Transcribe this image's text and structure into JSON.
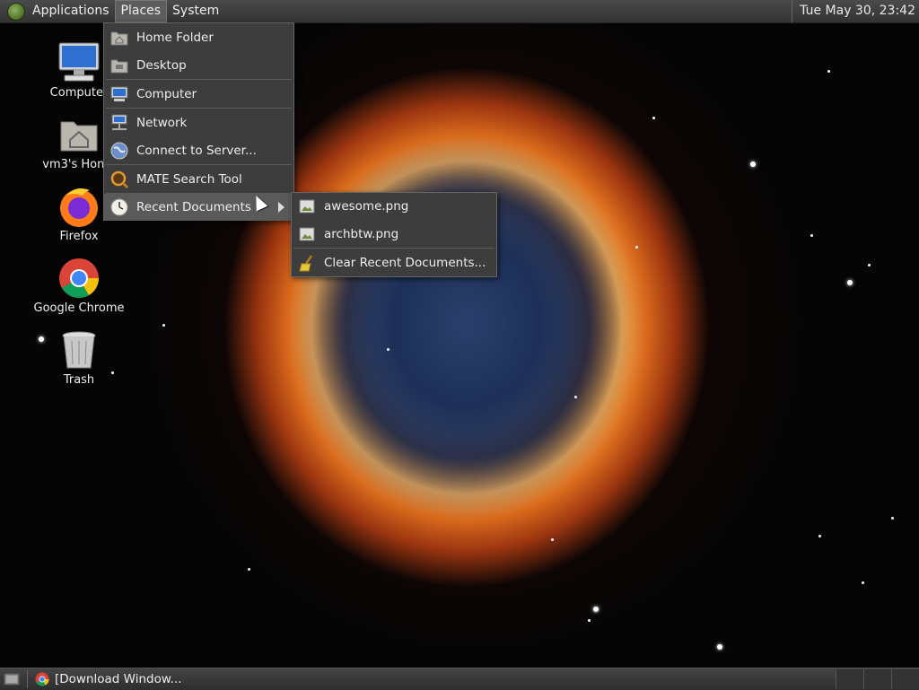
{
  "top_panel": {
    "menus": [
      "Applications",
      "Places",
      "System"
    ],
    "clock": "Tue May 30, 23:42"
  },
  "desktop_icons": [
    {
      "label": "Computer",
      "icon": "computer-icon"
    },
    {
      "label": "vm3's Home",
      "icon": "home-folder-icon"
    },
    {
      "label": "Firefox",
      "icon": "firefox-icon"
    },
    {
      "label": "Google Chrome",
      "icon": "chrome-icon"
    },
    {
      "label": "Trash",
      "icon": "trash-icon"
    }
  ],
  "places_menu": {
    "items": [
      {
        "label": "Home Folder",
        "icon": "home-folder-icon"
      },
      {
        "label": "Desktop",
        "icon": "desktop-folder-icon"
      },
      {
        "label": "Computer",
        "icon": "computer-icon"
      },
      {
        "label": "Network",
        "icon": "network-icon"
      },
      {
        "label": "Connect to Server...",
        "icon": "globe-icon"
      },
      {
        "label": "MATE Search Tool",
        "icon": "search-icon"
      },
      {
        "label": "Recent Documents",
        "icon": "clock-icon"
      }
    ]
  },
  "recent_menu": {
    "items": [
      {
        "label": "awesome.png",
        "icon": "image-file-icon"
      },
      {
        "label": "archbtw.png",
        "icon": "image-file-icon"
      },
      {
        "label": "Clear Recent Documents...",
        "icon": "broom-icon"
      }
    ]
  },
  "bottom_panel": {
    "task": "[Download Window..."
  },
  "colors": {
    "panel": "#3a3a3a",
    "menu_bg": "#3d3d3d",
    "menu_hover": "#5a5a5a"
  }
}
